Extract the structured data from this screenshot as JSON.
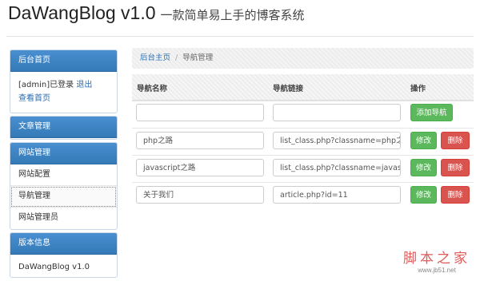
{
  "header": {
    "title": "DaWangBlog v1.0",
    "subtitle": "一款简单易上手的博客系统"
  },
  "sidebar": {
    "admin_panel": {
      "heading": "后台首页",
      "user_text": "[admin]已登录",
      "logout": "退出",
      "view_home": "查看首页"
    },
    "article_panel": {
      "heading": "文章管理"
    },
    "site_panel": {
      "heading": "网站管理",
      "items": [
        {
          "label": "网站配置"
        },
        {
          "label": "导航管理"
        },
        {
          "label": "网站管理员"
        }
      ]
    },
    "version_panel": {
      "heading": "版本信息",
      "text": "DaWangBlog v1.0"
    }
  },
  "breadcrumb": {
    "home": "后台主页",
    "separator": "/",
    "current": "导航管理"
  },
  "table": {
    "headers": {
      "name": "导航名称",
      "link": "导航链接",
      "action": "操作"
    },
    "add_button": "添加导航",
    "edit_button": "修改",
    "delete_button": "删除",
    "rows": [
      {
        "name": "php之路",
        "link": "list_class.php?classname=php之路"
      },
      {
        "name": "javascript之路",
        "link": "list_class.php?classname=javascript"
      },
      {
        "name": "关于我们",
        "link": "article.php?id=11"
      }
    ]
  },
  "watermark": {
    "line1": "脚本之家",
    "line2": "www.jb51.net"
  }
}
